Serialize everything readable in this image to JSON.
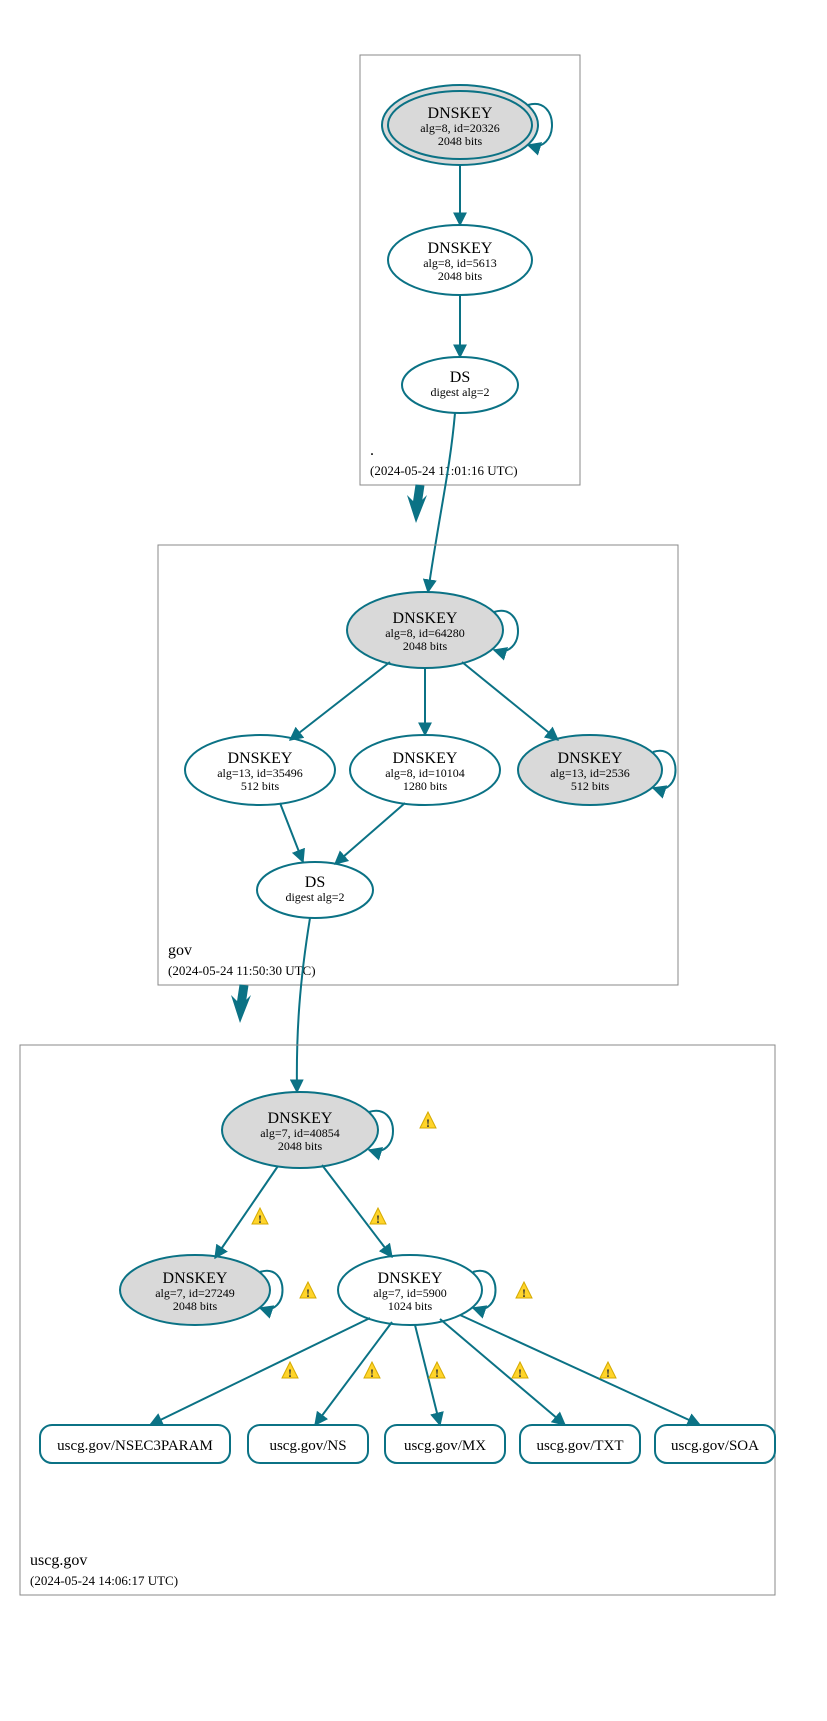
{
  "colors": {
    "teal": "#0b7285",
    "grey_fill": "#d9d9d9",
    "white": "#ffffff",
    "box": "#888888"
  },
  "zones": {
    "root": {
      "label": ".",
      "timestamp": "(2024-05-24 11:01:16 UTC)"
    },
    "gov": {
      "label": "gov",
      "timestamp": "(2024-05-24 11:50:30 UTC)"
    },
    "uscg": {
      "label": "uscg.gov",
      "timestamp": "(2024-05-24 14:06:17 UTC)"
    }
  },
  "nodes": {
    "root_ksk": {
      "title": "DNSKEY",
      "sub1": "alg=8, id=20326",
      "sub2": "2048 bits"
    },
    "root_zsk": {
      "title": "DNSKEY",
      "sub1": "alg=8, id=5613",
      "sub2": "2048 bits"
    },
    "root_ds": {
      "title": "DS",
      "sub1": "digest alg=2",
      "sub2": ""
    },
    "gov_ksk": {
      "title": "DNSKEY",
      "sub1": "alg=8, id=64280",
      "sub2": "2048 bits"
    },
    "gov_k1": {
      "title": "DNSKEY",
      "sub1": "alg=13, id=35496",
      "sub2": "512 bits"
    },
    "gov_k2": {
      "title": "DNSKEY",
      "sub1": "alg=8, id=10104",
      "sub2": "1280 bits"
    },
    "gov_k3": {
      "title": "DNSKEY",
      "sub1": "alg=13, id=2536",
      "sub2": "512 bits"
    },
    "gov_ds": {
      "title": "DS",
      "sub1": "digest alg=2",
      "sub2": ""
    },
    "uscg_ksk": {
      "title": "DNSKEY",
      "sub1": "alg=7, id=40854",
      "sub2": "2048 bits"
    },
    "uscg_k1": {
      "title": "DNSKEY",
      "sub1": "alg=7, id=27249",
      "sub2": "2048 bits"
    },
    "uscg_k2": {
      "title": "DNSKEY",
      "sub1": "alg=7, id=5900",
      "sub2": "1024 bits"
    },
    "leaf_nsec": {
      "label": "uscg.gov/NSEC3PARAM"
    },
    "leaf_ns": {
      "label": "uscg.gov/NS"
    },
    "leaf_mx": {
      "label": "uscg.gov/MX"
    },
    "leaf_txt": {
      "label": "uscg.gov/TXT"
    },
    "leaf_soa": {
      "label": "uscg.gov/SOA"
    }
  }
}
